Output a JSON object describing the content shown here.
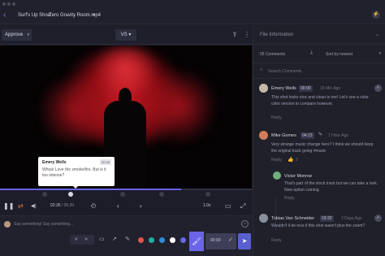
{
  "header": {
    "crumb_project": "Surf's Up Short",
    "crumb_file": "Zero Gravity Room.mp4",
    "caret": "▾",
    "back": "‹",
    "action_icon": "⚡"
  },
  "toolbar": {
    "approve_label": "Approve",
    "approve_caret": "▾",
    "vs_label": "VS ▾",
    "share_icon": "⇪",
    "more_icon": "⋮"
  },
  "video": {
    "note": {
      "name": "Emery Wells",
      "time": "00:30",
      "text": "Whoa! Love the smoke/fire. But is it too intense?"
    },
    "progress_fraction": 0.72
  },
  "controls": {
    "play_icon": "❚❚",
    "loop_icon": "⇄",
    "volume_icon": "◀)",
    "time_current": "02:35",
    "time_total": "/ 05:20",
    "clock_icon": "◴",
    "prev_icon": "‹",
    "next_icon": "›",
    "speed_label": "1.0x",
    "fullscreen_icon": "⤢",
    "screen_icon": "▭"
  },
  "comment_input": {
    "placeholder": "Say something! Say something...",
    "emoji_icon": "☺",
    "timecode": "00:00",
    "check_icon": "✓",
    "send_icon": "➤",
    "rewind_icon": "«",
    "forward_icon": "»",
    "rect_icon": "▭",
    "arrow_icon": "↗",
    "pen_icon": "✎",
    "brush_icon": "🖌",
    "swatches": [
      "#e2574c",
      "#1bb1a0",
      "#2e8bd8",
      "#ffffff",
      "#6a64e8"
    ]
  },
  "panel": {
    "title": "File Information",
    "caret": "⌄",
    "count": "05 Comments",
    "download_icon": "⤓",
    "sort_label": "Sort by newest",
    "sort_caret": "▾",
    "search_placeholder": "Search Comments",
    "search_icon": "⌕",
    "comments": [
      {
        "name": "Emery Wells",
        "time": "00:00",
        "ago": "15 Min Ago",
        "text": "This shot looks nice and clean to me! Let's see a color color version to compare however.",
        "reply": "Reply",
        "avatar_color": "#c7b8a6"
      },
      {
        "name": "Mike Gomes",
        "time": "04:23",
        "ago": "1 Hour Ago",
        "text": "Very strange music change here? I think we should keep the original track going #music",
        "reply": "Reply",
        "avatar_color": "#d27c5a",
        "likes": "2"
      },
      {
        "name": "Victor Monroe",
        "time": "",
        "ago": "",
        "text": "That's part of the stock track but we can take a look. New option coming.",
        "reply": "Reply",
        "avatar_color": "#6fae7d"
      },
      {
        "name": "Tobias Van Schneider",
        "time": "03:32",
        "ago": "2 Days Ago",
        "text": "Wouldn't it be nice if this shot wasn't plus the zoom?",
        "reply": "Reply",
        "avatar_color": "#8a8f9c"
      }
    ]
  }
}
